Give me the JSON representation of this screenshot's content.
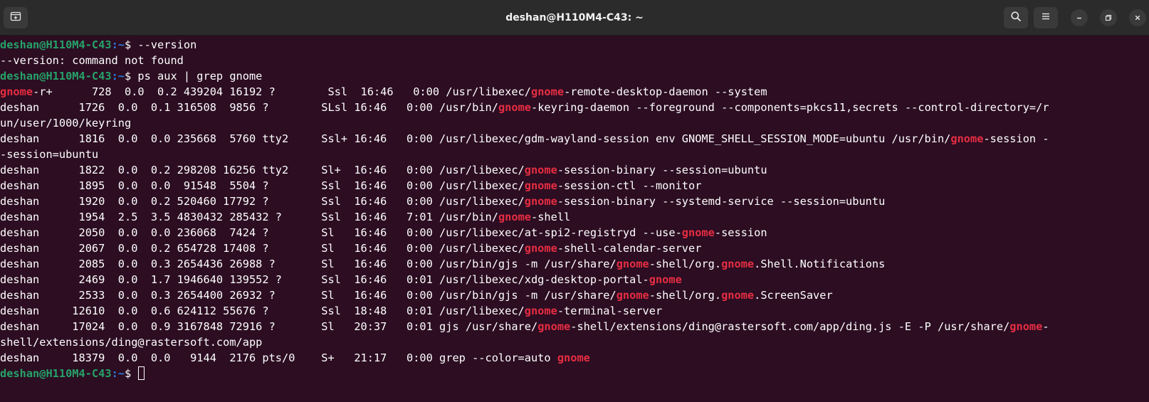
{
  "window": {
    "title": "deshan@H110M4-C43: ~"
  },
  "titlebar": {
    "icons": {
      "new_tab": "new-tab-icon",
      "search": "search-icon",
      "menu": "hamburger-menu-icon",
      "minimize": "minimize-icon",
      "maximize": "maximize-icon",
      "close": "close-icon"
    }
  },
  "colors": {
    "background": "#2c0d22",
    "titlebar": "#2b2b2b",
    "prompt_user": "#26a269",
    "prompt_path": "#2a7bde",
    "grep_match": "#e62d42",
    "text": "#ffffff"
  },
  "prompt": {
    "user_host": "deshan@H110M4-C43",
    "path": ":~",
    "symbol": "$ "
  },
  "terminal": {
    "lines": [
      {
        "type": "prompt",
        "command": "--version"
      },
      {
        "type": "output",
        "segments": [
          "--version: command not found"
        ]
      },
      {
        "type": "prompt",
        "command": "ps aux | grep gnome"
      },
      {
        "type": "output",
        "segments": [
          {
            "hl": "gnome"
          },
          "-r+      728  0.0  0.2 439204 16192 ?        Ssl  16:46   0:00 /usr/libexec/",
          {
            "hl": "gnome"
          },
          "-remote-desktop-daemon --system"
        ]
      },
      {
        "type": "output",
        "segments": [
          "deshan      1726  0.0  0.1 316508  9856 ?        SLsl 16:46   0:00 /usr/bin/",
          {
            "hl": "gnome"
          },
          "-keyring-daemon --foreground --components=pkcs11,secrets --control-directory=/r"
        ]
      },
      {
        "type": "output",
        "segments": [
          "un/user/1000/keyring"
        ]
      },
      {
        "type": "output",
        "segments": [
          "deshan      1816  0.0  0.0 235668  5760 tty2     Ssl+ 16:46   0:00 /usr/libexec/gdm-wayland-session env GNOME_SHELL_SESSION_MODE=ubuntu /usr/bin/",
          {
            "hl": "gnome"
          },
          "-session -"
        ]
      },
      {
        "type": "output",
        "segments": [
          "-session=ubuntu"
        ]
      },
      {
        "type": "output",
        "segments": [
          "deshan      1822  0.0  0.2 298208 16256 tty2     Sl+  16:46   0:00 /usr/libexec/",
          {
            "hl": "gnome"
          },
          "-session-binary --session=ubuntu"
        ]
      },
      {
        "type": "output",
        "segments": [
          "deshan      1895  0.0  0.0  91548  5504 ?        Ssl  16:46   0:00 /usr/libexec/",
          {
            "hl": "gnome"
          },
          "-session-ctl --monitor"
        ]
      },
      {
        "type": "output",
        "segments": [
          "deshan      1920  0.0  0.2 520460 17792 ?        Ssl  16:46   0:00 /usr/libexec/",
          {
            "hl": "gnome"
          },
          "-session-binary --systemd-service --session=ubuntu"
        ]
      },
      {
        "type": "output",
        "segments": [
          "deshan      1954  2.5  3.5 4830432 285432 ?      Ssl  16:46   7:01 /usr/bin/",
          {
            "hl": "gnome"
          },
          "-shell"
        ]
      },
      {
        "type": "output",
        "segments": [
          "deshan      2050  0.0  0.0 236068  7424 ?        Sl   16:46   0:00 /usr/libexec/at-spi2-registryd --use-",
          {
            "hl": "gnome"
          },
          "-session"
        ]
      },
      {
        "type": "output",
        "segments": [
          "deshan      2067  0.0  0.2 654728 17408 ?        Sl   16:46   0:00 /usr/libexec/",
          {
            "hl": "gnome"
          },
          "-shell-calendar-server"
        ]
      },
      {
        "type": "output",
        "segments": [
          "deshan      2085  0.0  0.3 2654436 26988 ?       Sl   16:46   0:00 /usr/bin/gjs -m /usr/share/",
          {
            "hl": "gnome"
          },
          "-shell/org.",
          {
            "hl": "gnome"
          },
          ".Shell.Notifications"
        ]
      },
      {
        "type": "output",
        "segments": [
          "deshan      2469  0.0  1.7 1946640 139552 ?      Ssl  16:46   0:01 /usr/libexec/xdg-desktop-portal-",
          {
            "hl": "gnome"
          }
        ]
      },
      {
        "type": "output",
        "segments": [
          "deshan      2533  0.0  0.3 2654400 26932 ?       Sl   16:46   0:00 /usr/bin/gjs -m /usr/share/",
          {
            "hl": "gnome"
          },
          "-shell/org.",
          {
            "hl": "gnome"
          },
          ".ScreenSaver"
        ]
      },
      {
        "type": "output",
        "segments": [
          "deshan     12610  0.0  0.6 624112 55676 ?        Ssl  18:48   0:01 /usr/libexec/",
          {
            "hl": "gnome"
          },
          "-terminal-server"
        ]
      },
      {
        "type": "output",
        "segments": [
          "deshan     17024  0.0  0.9 3167848 72916 ?       Sl   20:37   0:01 gjs /usr/share/",
          {
            "hl": "gnome"
          },
          "-shell/extensions/ding@rastersoft.com/app/ding.js -E -P /usr/share/",
          {
            "hl": "gnome"
          },
          "-"
        ]
      },
      {
        "type": "output",
        "segments": [
          "shell/extensions/ding@rastersoft.com/app"
        ]
      },
      {
        "type": "output",
        "segments": [
          "deshan     18379  0.0  0.0   9144  2176 pts/0    S+   21:17   0:00 grep --color=auto ",
          {
            "hl": "gnome"
          }
        ]
      },
      {
        "type": "prompt",
        "command": "",
        "cursor": true
      }
    ]
  }
}
